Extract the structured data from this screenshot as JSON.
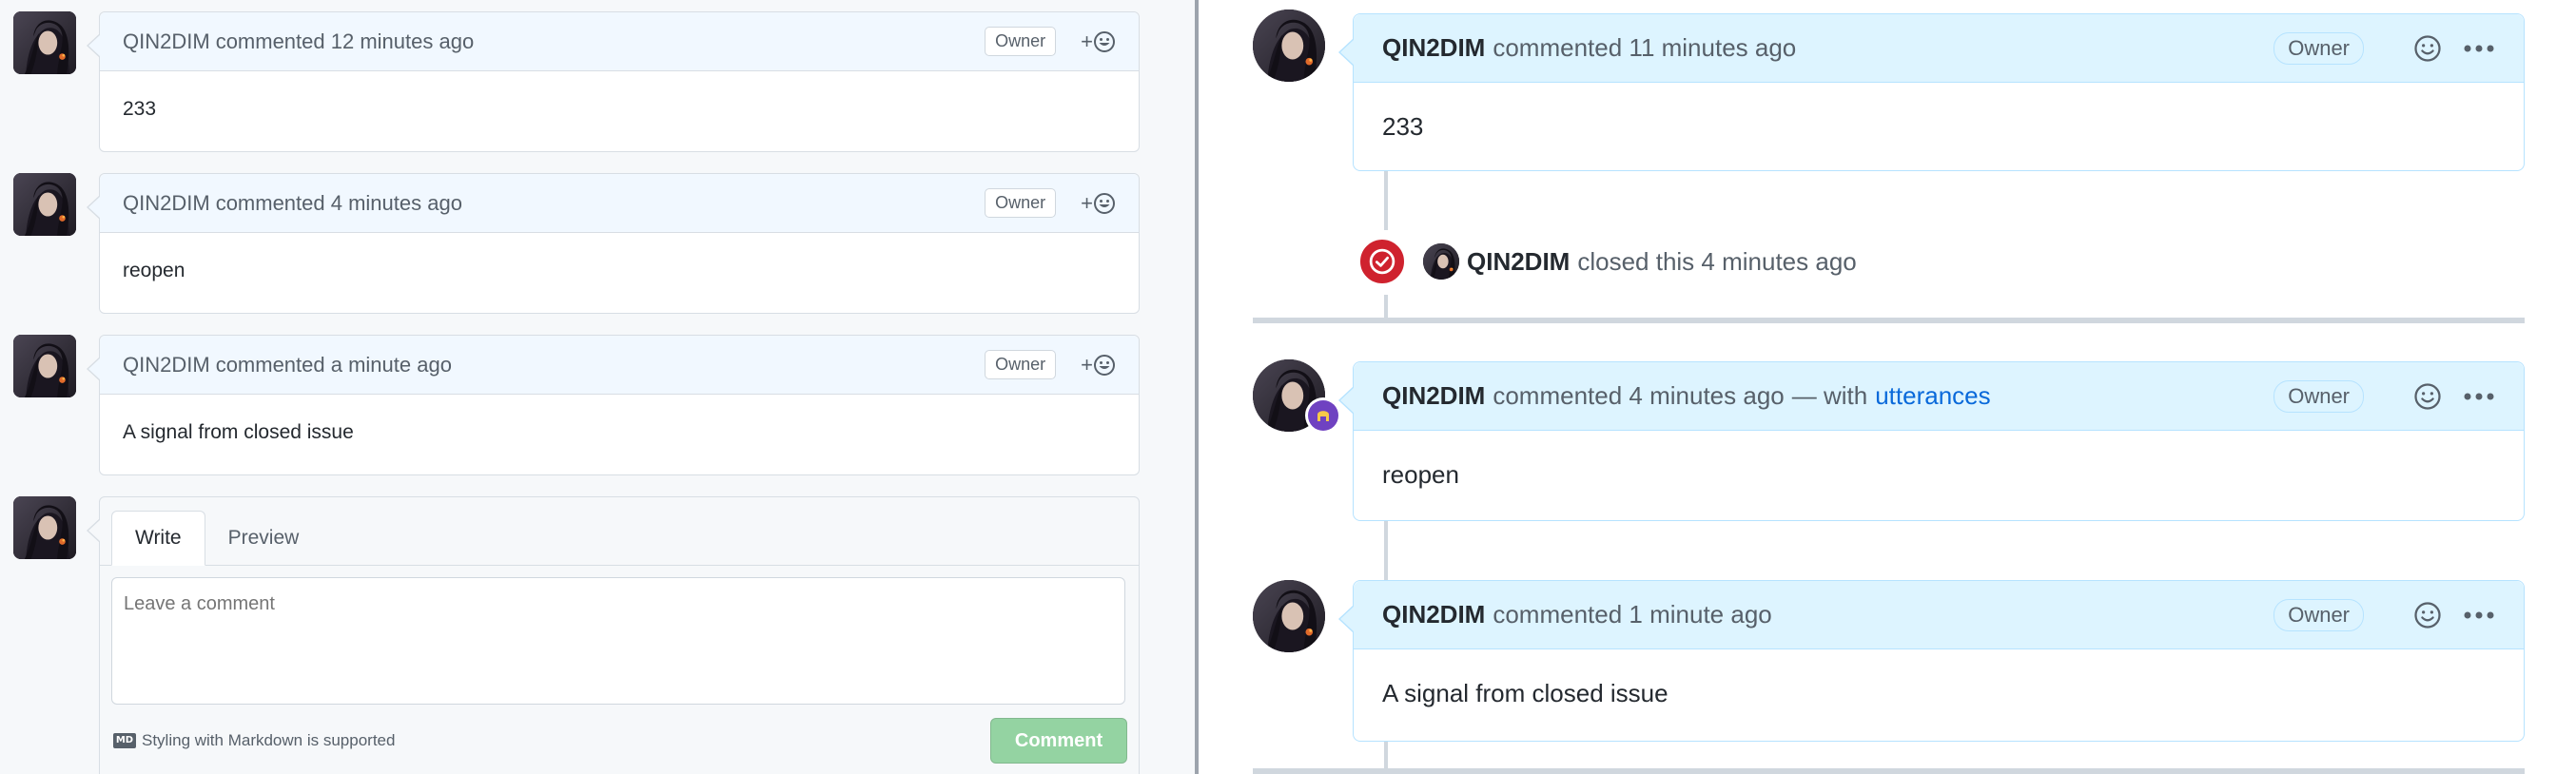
{
  "left": {
    "comments": [
      {
        "author": "QIN2DIM",
        "meta": "commented 12 minutes ago",
        "badge": "Owner",
        "reaction": "+",
        "body": "233"
      },
      {
        "author": "QIN2DIM",
        "meta": "commented 4 minutes ago",
        "badge": "Owner",
        "reaction": "+",
        "body": "reopen"
      },
      {
        "author": "QIN2DIM",
        "meta": "commented a minute ago",
        "badge": "Owner",
        "reaction": "+",
        "body": "A signal from closed issue"
      }
    ],
    "editor": {
      "tab_write": "Write",
      "tab_preview": "Preview",
      "placeholder": "Leave a comment",
      "md_badge": "MD",
      "md_note": "Styling with Markdown is supported",
      "submit": "Comment"
    }
  },
  "right": {
    "comments": [
      {
        "author": "QIN2DIM",
        "meta": "commented 11 minutes ago",
        "via": "",
        "via_link": "",
        "badge": "Owner",
        "body": "233"
      },
      {
        "author": "QIN2DIM",
        "meta": "commented 4 minutes ago",
        "via": "— with",
        "via_link": "utterances",
        "badge": "Owner",
        "body": "reopen"
      },
      {
        "author": "QIN2DIM",
        "meta": "commented 1 minute ago",
        "via": "",
        "via_link": "",
        "badge": "Owner",
        "body": "A signal from closed issue"
      }
    ],
    "event": {
      "author": "QIN2DIM",
      "text": "closed this 4 minutes ago"
    }
  },
  "colors": {
    "closed_red": "#cf222e",
    "link_blue": "#0969da",
    "comment_button_green": "#94d3a2",
    "header_blue": "#ddf4ff"
  }
}
